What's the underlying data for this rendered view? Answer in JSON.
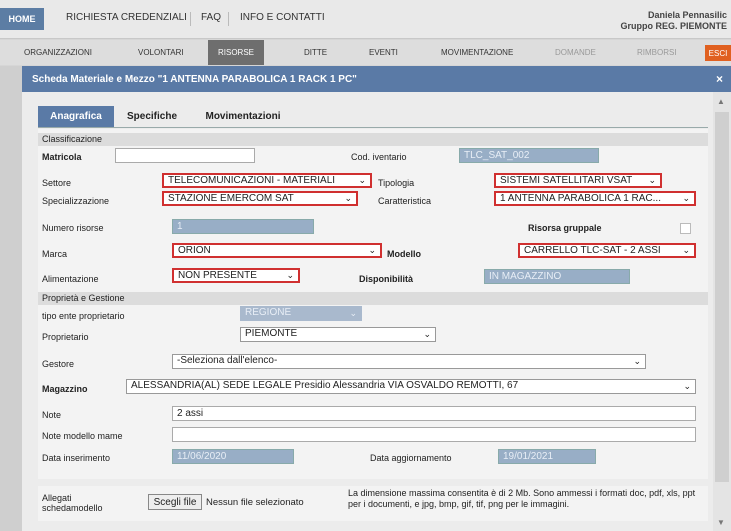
{
  "topnav": {
    "home": "HOME",
    "richiesta": "RICHIESTA CREDENZIALI",
    "faq": "FAQ",
    "info": "INFO E CONTATTI",
    "user_name": "Daniela Pennasilic",
    "user_group": "Gruppo REG. PIEMONTE"
  },
  "menu": {
    "organizzazioni": "ORGANIZZAZIONI",
    "volontari": "VOLONTARI",
    "risorse": "RISORSE",
    "ditte": "DITTE",
    "eventi": "EVENTI",
    "movimentazione": "MOVIMENTAZIONE",
    "domande": "DOMANDE",
    "rimborsi": "RIMBORSI",
    "esci": "ESCI"
  },
  "modal": {
    "title": "Scheda Materiale e Mezzo \"1 ANTENNA PARABOLICA 1 RACK 1 PC\"",
    "close": "×"
  },
  "tabs": [
    "Anagrafica",
    "Specifiche",
    "Movimentazioni"
  ],
  "form": {
    "classificazione": "Classificazione",
    "matricola_label": "Matricola",
    "matricola_value": "",
    "cod_inventario_label": "Cod. iventario",
    "cod_inventario_value": "TLC_SAT_002",
    "settore_label": "Settore",
    "settore_value": "TELECOMUNICAZIONI - MATERIALI",
    "tipologia_label": "Tipologia",
    "tipologia_value": "SISTEMI SATELLITARI VSAT",
    "specializzazione_label": "Specializzazione",
    "specializzazione_value": "STAZIONE EMERCOM SAT",
    "caratteristica_label": "Caratteristica",
    "caratteristica_value": "1 ANTENNA PARABOLICA 1 RAC...",
    "numero_risorse_label": "Numero risorse",
    "numero_risorse_value": "1",
    "risorsa_gruppale_label": "Risorsa gruppale",
    "marca_label": "Marca",
    "marca_value": "ORION",
    "modello_label": "Modello",
    "modello_value": "CARRELLO TLC-SAT - 2 ASSI",
    "alimentazione_label": "Alimentazione",
    "alimentazione_value": "NON PRESENTE",
    "disponibilita_label": "Disponibilità",
    "disponibilita_value": "IN MAGAZZINO",
    "proprieta": "Proprietà e Gestione",
    "tipo_ente_label": "tipo ente proprietario",
    "tipo_ente_value": "REGIONE",
    "proprietario_label": "Proprietario",
    "proprietario_value": "PIEMONTE",
    "gestore_label": "Gestore",
    "gestore_value": "-Seleziona dall'elenco-",
    "magazzino_label": "Magazzino",
    "magazzino_value": "ALESSANDRIA(AL) SEDE LEGALE Presidio Alessandria VIA OSVALDO REMOTTI, 67",
    "note_label": "Note",
    "note_value": "2 assi",
    "note_modello_label": "Note modello mame",
    "note_modello_value": "",
    "data_inserimento_label": "Data inserimento",
    "data_inserimento_value": "11/06/2020",
    "data_aggiornamento_label": "Data aggiornamento",
    "data_aggiornamento_value": "19/01/2021"
  },
  "allegati": {
    "label_line1": "Allegati",
    "label_line2": "schedamodello",
    "button": "Scegli file",
    "no_file": "Nessun file selezionato",
    "note": "La dimensione massima consentita è di 2 Mb. Sono ammessi i formati doc, pdf, xls, ppt per i documenti, e jpg, bmp, gif, tif, png per le immagini."
  },
  "colors": {
    "header_blue": "#5a7aa6",
    "required_red": "#d03030",
    "readonly_blue": "#98aec6",
    "esci_orange": "#e06020"
  }
}
